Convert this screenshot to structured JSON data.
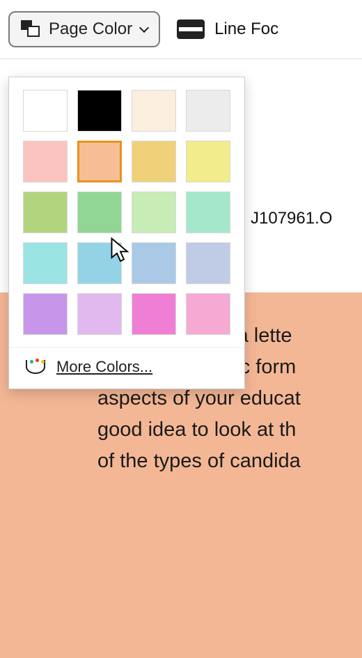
{
  "toolbar": {
    "page_color_label": "Page Color",
    "line_focus_label": "Line Foc"
  },
  "dropdown": {
    "swatches": [
      {
        "color": "#ffffff",
        "selected": false
      },
      {
        "color": "#000000",
        "selected": false
      },
      {
        "color": "#fbeede",
        "selected": false
      },
      {
        "color": "#ececec",
        "selected": false
      },
      {
        "color": "#fcc4c0",
        "selected": false
      },
      {
        "color": "#f7be95",
        "selected": true
      },
      {
        "color": "#f0d17a",
        "selected": false
      },
      {
        "color": "#f2ec8a",
        "selected": false
      },
      {
        "color": "#b3d47f",
        "selected": false
      },
      {
        "color": "#92d695",
        "selected": false
      },
      {
        "color": "#c8ecb6",
        "selected": false
      },
      {
        "color": "#a4e8cc",
        "selected": false
      },
      {
        "color": "#9be4e4",
        "selected": false
      },
      {
        "color": "#94d3e6",
        "selected": false
      },
      {
        "color": "#a9c9e6",
        "selected": false
      },
      {
        "color": "#c0cbe6",
        "selected": false
      },
      {
        "color": "#c796ea",
        "selected": false
      },
      {
        "color": "#e1b9ef",
        "selected": false
      },
      {
        "color": "#ef7fd4",
        "selected": false
      },
      {
        "color": "#f6a9d2",
        "selected": false
      }
    ],
    "more_label": "More Colors..."
  },
  "document": {
    "filename_fragment": "J107961.O",
    "body_lines": [
      "I'd love to write a lette",
      "require a specific form",
      "aspects of your educat",
      "good idea to look at th",
      "of the types of candida"
    ],
    "page_bg": "#f4b795"
  }
}
